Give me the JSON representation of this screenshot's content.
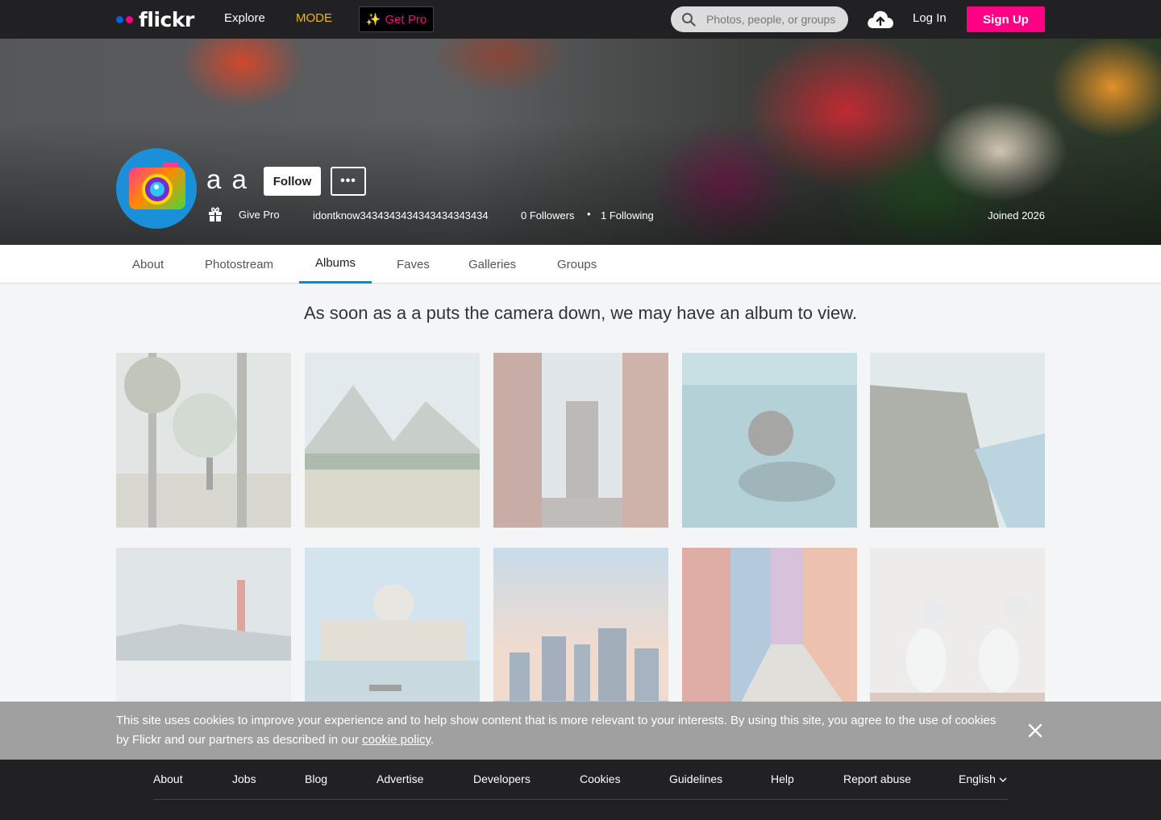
{
  "nav": {
    "logo": "flickr",
    "explore": "Explore",
    "mode": "MODE",
    "get_pro": "Get Pro",
    "search_placeholder": "Photos, people, or groups",
    "login": "Log In",
    "signup": "Sign Up"
  },
  "profile": {
    "real_name": "a a",
    "follow": "Follow",
    "more": "•••",
    "give_pro": "Give Pro",
    "username": "idontknow3434343434343434343434",
    "followers": "0 Followers",
    "separator": "•",
    "following": "1 Following",
    "joined": "Joined 2026"
  },
  "tabs": [
    "About",
    "Photostream",
    "Albums",
    "Faves",
    "Galleries",
    "Groups"
  ],
  "active_tab": "Albums",
  "empty_message": "As soon as a a puts the camera down, we may have an album to view.",
  "cookie": {
    "text": "This site uses cookies to improve your experience and to help show content that is more relevant to your interests. By using this site, you agree to the use of cookies by Flickr and our partners as described in our",
    "link": "cookie policy",
    "end": "."
  },
  "footer": {
    "links": [
      "About",
      "Jobs",
      "Blog",
      "Advertise",
      "Developers",
      "Cookies",
      "Guidelines",
      "Help",
      "Report abuse",
      "English"
    ]
  },
  "colors": {
    "nav_bg": "#212124",
    "brand_blue": "#0063dc",
    "brand_pink": "#ff0084",
    "mode_yellow": "#f5b800",
    "tab_active": "#008ecf"
  }
}
